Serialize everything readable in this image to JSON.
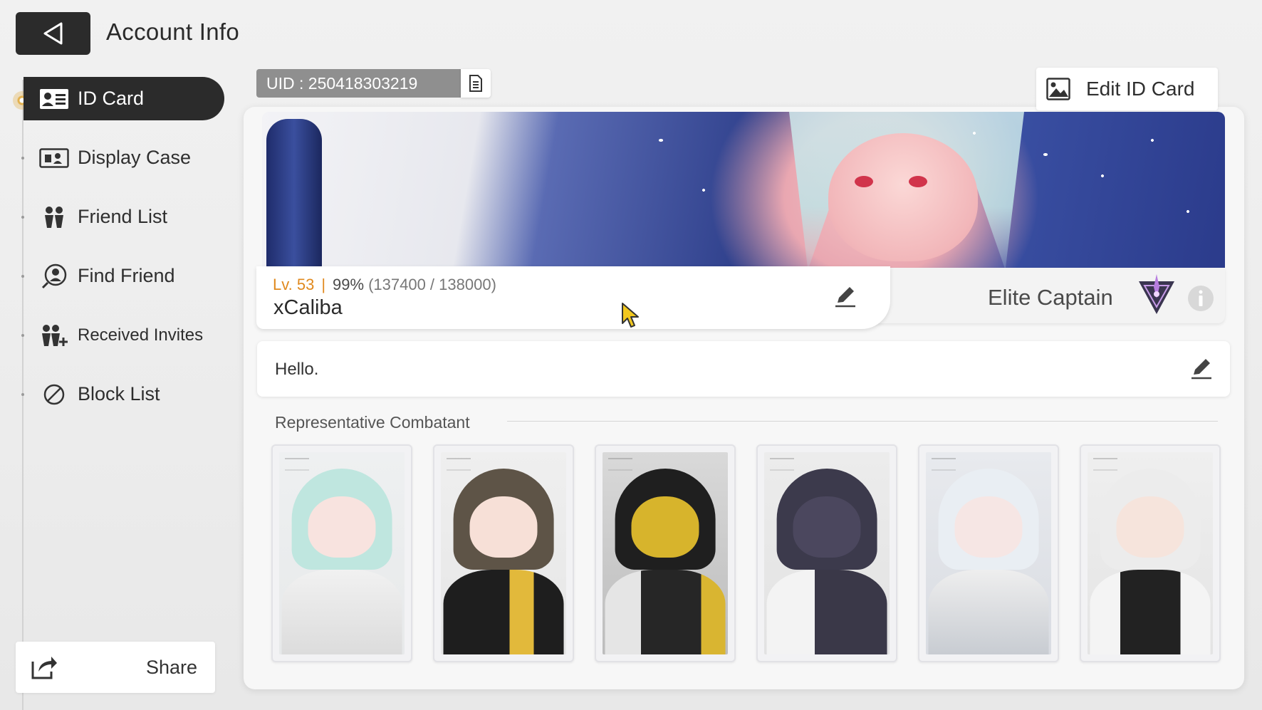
{
  "header": {
    "title": "Account Info"
  },
  "sidebar": {
    "items": [
      {
        "label": "ID Card",
        "icon": "id-card-icon",
        "active": true
      },
      {
        "label": "Display Case",
        "icon": "display-case-icon",
        "active": false
      },
      {
        "label": "Friend List",
        "icon": "friends-icon",
        "active": false
      },
      {
        "label": "Find Friend",
        "icon": "find-friend-icon",
        "active": false
      },
      {
        "label": "Received Invites",
        "icon": "invite-icon",
        "active": false
      },
      {
        "label": "Block List",
        "icon": "block-icon",
        "active": false
      }
    ],
    "share_label": "Share"
  },
  "card": {
    "uid": "UID : 250418303219",
    "edit_label": "Edit ID Card",
    "level": "Lv. 53",
    "exp_percent": "99%",
    "exp_progress": "(137400 / 138000)",
    "player_name": "xCaliba",
    "title": "Elite Captain",
    "greeting": "Hello."
  },
  "combatants": {
    "section_label": "Representative Combatant",
    "items": [
      {
        "icon": "combatant-portrait-1"
      },
      {
        "icon": "combatant-portrait-2"
      },
      {
        "icon": "combatant-portrait-3"
      },
      {
        "icon": "combatant-portrait-4"
      },
      {
        "icon": "combatant-portrait-5"
      },
      {
        "icon": "combatant-portrait-6"
      }
    ]
  },
  "colors": {
    "accent_dark": "#2b2b2b",
    "level_orange": "#e0891e",
    "uid_gray": "#8f8f8f"
  }
}
